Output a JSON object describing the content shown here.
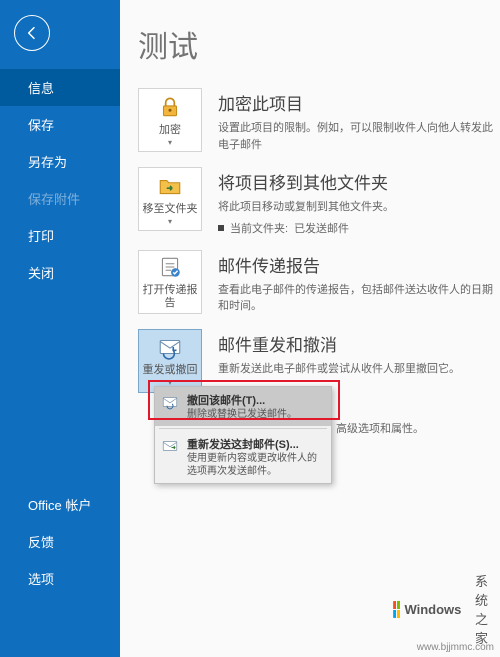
{
  "sidebar": {
    "items": [
      {
        "label": "信息"
      },
      {
        "label": "保存"
      },
      {
        "label": "另存为"
      },
      {
        "label": "保存附件"
      },
      {
        "label": "打印"
      },
      {
        "label": "关闭"
      }
    ],
    "bottom": [
      {
        "label": "Office 帐户"
      },
      {
        "label": "反馈"
      },
      {
        "label": "选项"
      }
    ]
  },
  "page_title": "测试",
  "sections": [
    {
      "tile_label": "加密",
      "has_dropdown": true,
      "title": "加密此项目",
      "desc": "设置此项目的限制。例如，可以限制收件人向他人转发此电子邮件"
    },
    {
      "tile_label": "移至文件夹",
      "has_dropdown": true,
      "title": "将项目移到其他文件夹",
      "desc": "将此项目移动或复制到其他文件夹。",
      "bullet_label": "当前文件夹:",
      "bullet_value": "已发送邮件"
    },
    {
      "tile_label": "打开传递报告",
      "has_dropdown": false,
      "title": "邮件传递报告",
      "desc": "查看此电子邮件的传递报告，包括邮件送达收件人的日期和时间。"
    },
    {
      "tile_label": "重发或撤回",
      "has_dropdown": true,
      "title": "邮件重发和撤消",
      "desc": "重新发送此电子邮件或尝试从收件人那里撤回它。"
    }
  ],
  "trail_text": "高级选项和属性。",
  "dropdown": {
    "items": [
      {
        "title": "撤回该邮件(T)...",
        "desc": "删除或替换已发送邮件。"
      },
      {
        "title": "重新发送这封邮件(S)...",
        "desc": "使用更新内容或更改收件人的选项再次发送邮件。"
      }
    ]
  },
  "watermark": {
    "brand": "Windows",
    "suffix": "系统之家",
    "url": "www.bjjmmc.com"
  }
}
